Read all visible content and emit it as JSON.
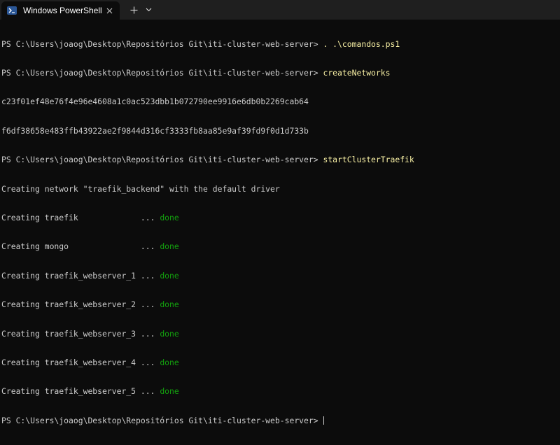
{
  "window": {
    "tab_title": "Windows PowerShell",
    "tab_icon": "powershell-icon",
    "new_tab_glyph": "+",
    "dropdown_icon": "chevron-down-icon",
    "close_icon": "close-icon"
  },
  "colors": {
    "background": "#0c0c0c",
    "text": "#cccccc",
    "command": "#f9f1a5",
    "done": "#13a10e"
  },
  "terminal": {
    "prompt": "PS C:\\Users\\joaog\\Desktop\\Repositórios Git\\iti-cluster-web-server> ",
    "cmd1": ". .\\comandos.ps1",
    "cmd2": "createNetworks",
    "hash1": "c23f01ef48e76f4e96e4608a1c0ac523dbb1b072790ee9916e6db0b2269cab64",
    "hash2": "f6df38658e483ffb43922ae2f9844d316cf3333fb8aa85e9af39fd9f0d1d733b",
    "cmd3": "startClusterTraefik",
    "network_msg": "Creating network \"traefik_backend\" with the default driver",
    "creating": [
      {
        "label": "Creating traefik             ... ",
        "status": "done"
      },
      {
        "label": "Creating mongo               ... ",
        "status": "done"
      },
      {
        "label": "Creating traefik_webserver_1 ... ",
        "status": "done"
      },
      {
        "label": "Creating traefik_webserver_2 ... ",
        "status": "done"
      },
      {
        "label": "Creating traefik_webserver_3 ... ",
        "status": "done"
      },
      {
        "label": "Creating traefik_webserver_4 ... ",
        "status": "done"
      },
      {
        "label": "Creating traefik_webserver_5 ... ",
        "status": "done"
      }
    ]
  }
}
